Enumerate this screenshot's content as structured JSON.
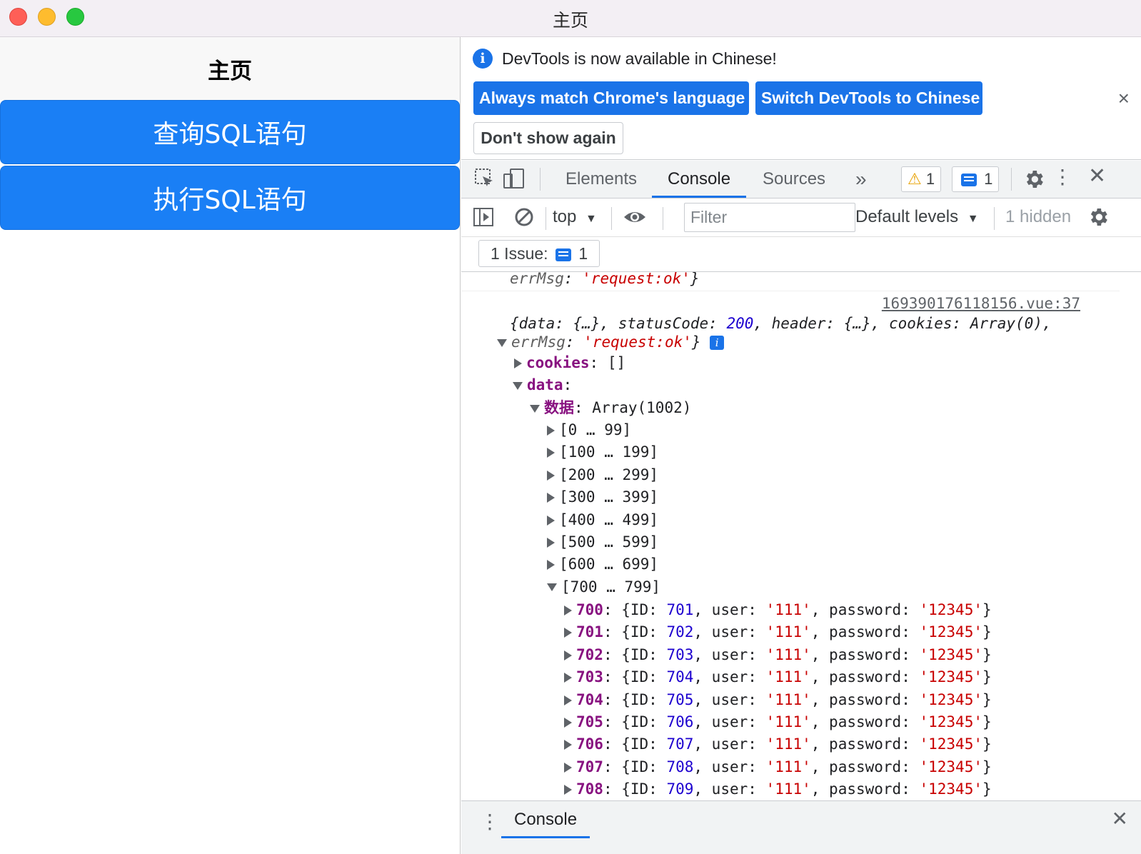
{
  "window": {
    "title": "主页"
  },
  "app": {
    "header": "主页",
    "buttons": [
      "查询SQL语句",
      "执行SQL语句"
    ]
  },
  "devtools": {
    "infobar": {
      "message": "DevTools is now available in Chinese!",
      "match_btn": "Always match Chrome's language",
      "switch_btn": "Switch DevTools to Chinese",
      "dont_btn": "Don't show again",
      "close": "×"
    },
    "tabs": [
      "Elements",
      "Console",
      "Sources"
    ],
    "more_tabs": "»",
    "warnings": "1",
    "messages": "1",
    "filterbar": {
      "context": "top",
      "filter_placeholder": "Filter",
      "levels": "Default levels",
      "hidden": "1 hidden"
    },
    "issues": {
      "label": "1 Issue:",
      "count": "1"
    },
    "console": {
      "prev_line": {
        "key": "errMsg",
        "value": "'request:ok'"
      },
      "source": "169390176118156.vue:37",
      "summary": {
        "status_code": "200",
        "err_msg": "'request:ok'"
      },
      "cookies": {
        "key": "cookies",
        "value": "[]"
      },
      "data_key": "data",
      "array_key": "数据",
      "array_label": "Array(1002)",
      "ranges": [
        "[0 … 99]",
        "[100 … 199]",
        "[200 … 299]",
        "[300 … 399]",
        "[400 … 499]",
        "[500 … 599]",
        "[600 … 699]",
        "[700 … 799]"
      ],
      "rows": [
        {
          "index": "700",
          "id": "701",
          "user": "'111'",
          "password": "'12345'"
        },
        {
          "index": "701",
          "id": "702",
          "user": "'111'",
          "password": "'12345'"
        },
        {
          "index": "702",
          "id": "703",
          "user": "'111'",
          "password": "'12345'"
        },
        {
          "index": "703",
          "id": "704",
          "user": "'111'",
          "password": "'12345'"
        },
        {
          "index": "704",
          "id": "705",
          "user": "'111'",
          "password": "'12345'"
        },
        {
          "index": "705",
          "id": "706",
          "user": "'111'",
          "password": "'12345'"
        },
        {
          "index": "706",
          "id": "707",
          "user": "'111'",
          "password": "'12345'"
        },
        {
          "index": "707",
          "id": "708",
          "user": "'111'",
          "password": "'12345'"
        },
        {
          "index": "708",
          "id": "709",
          "user": "'111'",
          "password": "'12345'"
        }
      ]
    },
    "drawer": {
      "tab": "Console"
    }
  }
}
